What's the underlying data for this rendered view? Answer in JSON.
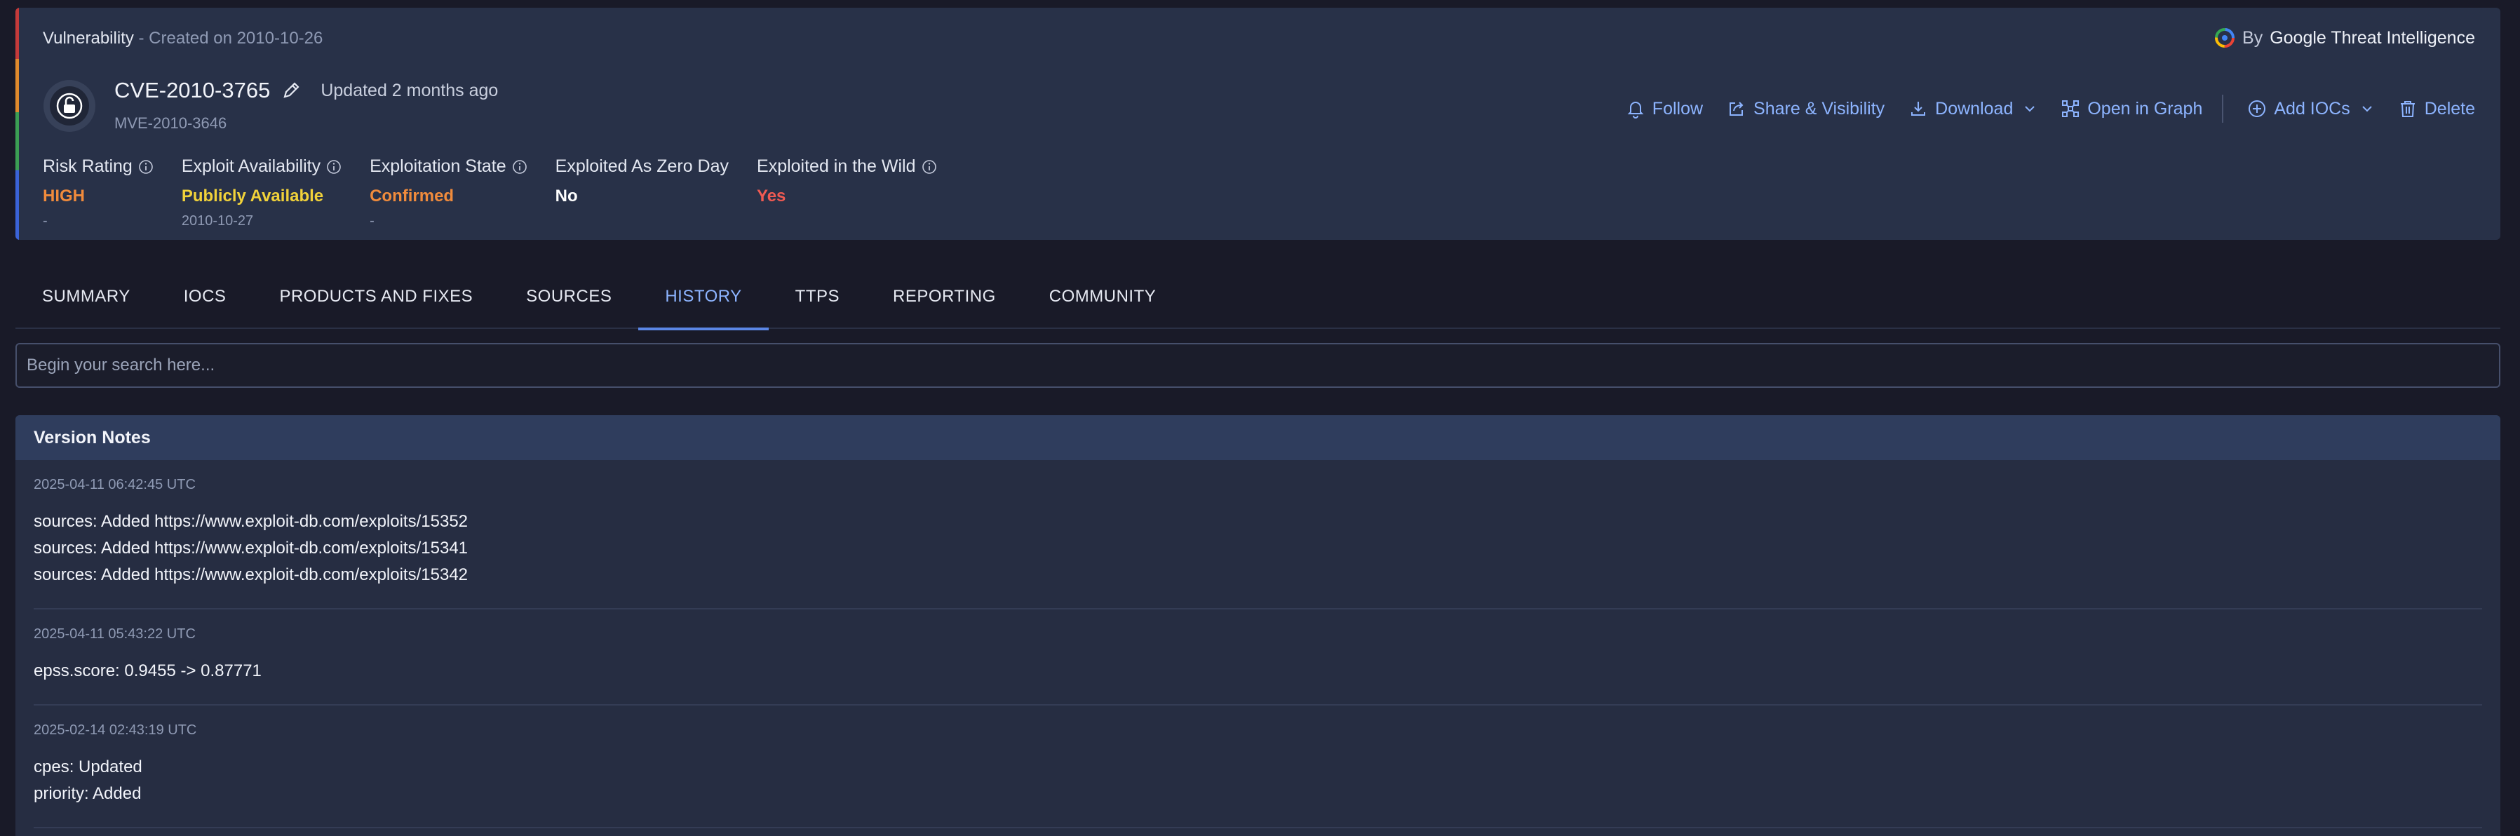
{
  "header": {
    "type": "Vulnerability",
    "created": " - Created on 2010-10-26",
    "by": "By",
    "brand": "Google Threat Intelligence",
    "cve_id": "CVE-2010-3765",
    "updated": "Updated 2 months ago",
    "mve_id": "MVE-2010-3646"
  },
  "actions": {
    "follow": "Follow",
    "share": "Share & Visibility",
    "download": "Download",
    "open_graph": "Open in Graph",
    "add_iocs": "Add IOCs",
    "delete": "Delete"
  },
  "metrics": [
    {
      "label": "Risk Rating",
      "value": "HIGH",
      "sub": "-",
      "color": "#f08b3c"
    },
    {
      "label": "Exploit Availability",
      "value": "Publicly Available",
      "sub": "2010-10-27",
      "color": "#f1d23a"
    },
    {
      "label": "Exploitation State",
      "value": "Confirmed",
      "sub": "-",
      "color": "#f08b3c"
    },
    {
      "label": "Exploited As Zero Day",
      "value": "No",
      "sub": "",
      "color": "#ffffff"
    },
    {
      "label": "Exploited in the Wild",
      "value": "Yes",
      "sub": "",
      "color": "#f05a52"
    }
  ],
  "tabs": [
    "SUMMARY",
    "IOCS",
    "PRODUCTS AND FIXES",
    "SOURCES",
    "HISTORY",
    "TTPS",
    "REPORTING",
    "COMMUNITY"
  ],
  "active_tab": "HISTORY",
  "search": {
    "placeholder": "Begin your search here..."
  },
  "notes": {
    "title": "Version Notes",
    "entries": [
      {
        "timestamp": "2025-04-11 06:42:45 UTC",
        "lines": [
          "sources: Added https://www.exploit-db.com/exploits/15352",
          "sources: Added https://www.exploit-db.com/exploits/15341",
          "sources: Added https://www.exploit-db.com/exploits/15342"
        ]
      },
      {
        "timestamp": "2025-04-11 05:43:22 UTC",
        "lines": [
          "epss.score: 0.9455 -> 0.87771"
        ]
      },
      {
        "timestamp": "2025-02-14 02:43:19 UTC",
        "lines": [
          "cpes: Updated",
          "priority: Added"
        ]
      }
    ]
  }
}
